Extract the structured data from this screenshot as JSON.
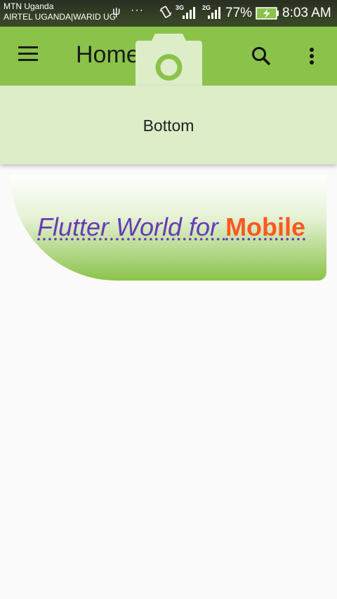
{
  "status_bar": {
    "carrier_1": "MTN Uganda",
    "carrier_2": "AIRTEL UGANDA|WARID UG",
    "usb_icon": "usb-icon",
    "overflow": "···",
    "network_1": "3G",
    "network_2": "2G",
    "battery_percent": "77%",
    "time": "8:03 AM"
  },
  "app_bar": {
    "title": "Home",
    "background": "#8bc34a",
    "icons": [
      "menu-icon",
      "camera-icon",
      "search-icon",
      "more-vert-icon"
    ]
  },
  "bottom": {
    "label": "Bottom",
    "background": "#dcedc8"
  },
  "card": {
    "text_part1": "Flutter World for ",
    "text_part2": "Mobile",
    "color_part1": "#673ab7",
    "color_part2": "#ff5722"
  }
}
